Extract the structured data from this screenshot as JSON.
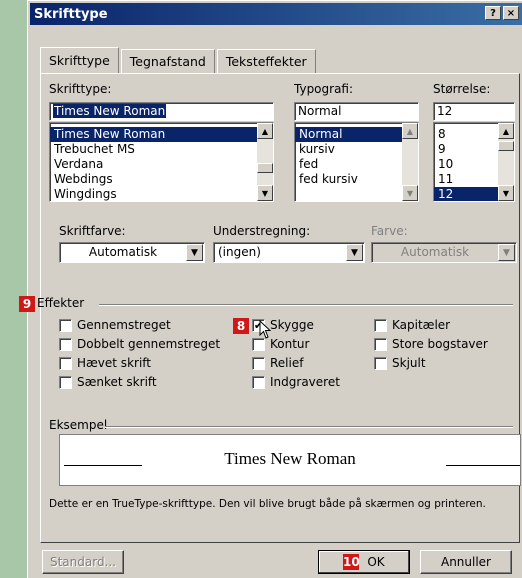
{
  "window": {
    "title": "Skrifttype",
    "help_button": "?",
    "close_button": "×"
  },
  "tabs": [
    "Skrifttype",
    "Tegnafstand",
    "Teksteffekter"
  ],
  "font": {
    "label": "Skrifttype:",
    "value": "Times New Roman",
    "list": [
      "Times New Roman",
      "Trebuchet MS",
      "Verdana",
      "Webdings",
      "Wingdings"
    ]
  },
  "style": {
    "label": "Typografi:",
    "value": "Normal",
    "list": [
      "Normal",
      "kursiv",
      "fed",
      "fed kursiv"
    ]
  },
  "size": {
    "label": "Størrelse:",
    "value": "12",
    "list": [
      "8",
      "9",
      "10",
      "11",
      "12"
    ]
  },
  "color": {
    "label": "Skriftfarve:",
    "value": "Automatisk"
  },
  "underline": {
    "label": "Understregning:",
    "value": "(ingen)"
  },
  "underline_color": {
    "label": "Farve:",
    "value": "Automatisk"
  },
  "effects": {
    "title": "Effekter",
    "col1": [
      "Gennemstreget",
      "Dobbelt gennemstreget",
      "Hævet skrift",
      "Sænket skrift"
    ],
    "col2": [
      "Skygge",
      "Kontur",
      "Relief",
      "Indgraveret"
    ],
    "col3": [
      "Kapitæler",
      "Store bogstaver",
      "Skjult"
    ],
    "checked": [
      "Skygge"
    ]
  },
  "badges": {
    "effects": "9",
    "shadow": "8",
    "ok": "10"
  },
  "preview": {
    "title": "Eksempel",
    "text": "Times New Roman",
    "note": "Dette er en TrueType-skrifttype. Den vil blive brugt både på skærmen og printeren."
  },
  "buttons": {
    "default": "Standard...",
    "ok": "OK",
    "cancel": "Annuller"
  },
  "colors": {
    "titlebar": "#0a246a",
    "selection": "#0a246a",
    "badge": "#d01818",
    "dialog": "#d4d0c8"
  }
}
